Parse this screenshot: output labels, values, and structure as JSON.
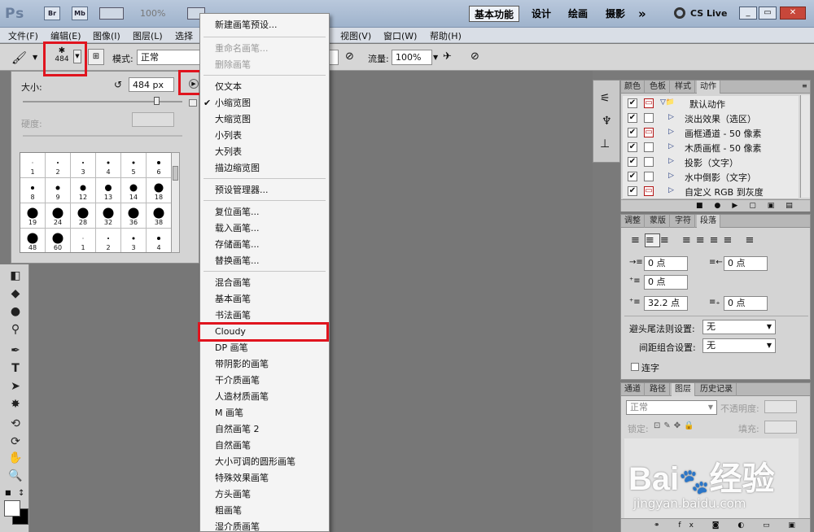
{
  "titlebar": {
    "app_logo": "Ps",
    "br_label": "Br",
    "mb_label": "Mb",
    "zoom": "100%",
    "workspaces": [
      "基本功能",
      "设计",
      "绘画",
      "摄影"
    ],
    "overflow": "»",
    "cs_live": "CS Live"
  },
  "menubar": {
    "items": [
      "文件(F)",
      "编辑(E)",
      "图像(I)",
      "图层(L)",
      "选择",
      "视图(V)",
      "窗口(W)",
      "帮助(H)"
    ]
  },
  "options": {
    "brush_size_small": "484",
    "mode_label": "模式:",
    "mode_value": "正常",
    "flow_label": "流量:",
    "flow_value": "100%"
  },
  "brush_panel": {
    "size_label": "大小:",
    "size_value": "484 px",
    "hardness_label": "硬度:",
    "presets": [
      "1",
      "2",
      "3",
      "4",
      "5",
      "6",
      "8",
      "9",
      "12",
      "13",
      "14",
      "18",
      "19",
      "24",
      "28",
      "32",
      "36",
      "38",
      "48",
      "60",
      "1",
      "2",
      "3",
      "4"
    ]
  },
  "dropdown": {
    "items": [
      {
        "label": "新建画笔预设...",
        "disabled": false
      },
      {
        "label": "重命名画笔...",
        "disabled": true
      },
      {
        "label": "删除画笔",
        "disabled": true
      },
      {
        "label": "仅文本",
        "disabled": false
      },
      {
        "label": "小缩览图",
        "disabled": false,
        "checked": true
      },
      {
        "label": "大缩览图",
        "disabled": false
      },
      {
        "label": "小列表",
        "disabled": false
      },
      {
        "label": "大列表",
        "disabled": false
      },
      {
        "label": "描边缩览图",
        "disabled": false
      },
      {
        "label": "预设管理器...",
        "disabled": false
      },
      {
        "label": "复位画笔...",
        "disabled": false
      },
      {
        "label": "载入画笔...",
        "disabled": false
      },
      {
        "label": "存储画笔...",
        "disabled": false
      },
      {
        "label": "替换画笔...",
        "disabled": false
      },
      {
        "label": "混合画笔",
        "disabled": false
      },
      {
        "label": "基本画笔",
        "disabled": false
      },
      {
        "label": "书法画笔",
        "disabled": false
      },
      {
        "label": "Cloudy",
        "disabled": false
      },
      {
        "label": "DP 画笔",
        "disabled": false
      },
      {
        "label": "带阴影的画笔",
        "disabled": false
      },
      {
        "label": "干介质画笔",
        "disabled": false
      },
      {
        "label": "人造材质画笔",
        "disabled": false
      },
      {
        "label": "M 画笔",
        "disabled": false
      },
      {
        "label": "自然画笔 2",
        "disabled": false
      },
      {
        "label": "自然画笔",
        "disabled": false
      },
      {
        "label": "大小可调的圆形画笔",
        "disabled": false
      },
      {
        "label": "特殊效果画笔",
        "disabled": false
      },
      {
        "label": "方头画笔",
        "disabled": false
      },
      {
        "label": "粗画笔",
        "disabled": false
      },
      {
        "label": "湿介质画笔",
        "disabled": false
      }
    ]
  },
  "actions_panel": {
    "tabs": [
      "颜色",
      "色板",
      "样式",
      "动作"
    ],
    "rows": [
      "默认动作",
      "淡出效果（选区）",
      "画框通道 - 50 像素",
      "木质画框 - 50 像素",
      "投影（文字）",
      "水中倒影（文字）",
      "自定义 RGB 到灰度"
    ]
  },
  "paragraph_panel": {
    "tabs": [
      "调整",
      "蒙版",
      "字符",
      "段落"
    ],
    "indent_left": "0 点",
    "indent_right": "0 点",
    "indent_first": "0 点",
    "space_before": "32.2 点",
    "space_after": "0 点",
    "kinsoku_label": "避头尾法则设置:",
    "kinsoku_value": "无",
    "mojikumi_label": "间距组合设置:",
    "mojikumi_value": "无",
    "hyphenate_label": "连字"
  },
  "layers_panel": {
    "tabs": [
      "通道",
      "路径",
      "图层",
      "历史记录"
    ],
    "blend_mode": "正常",
    "opacity_label": "不透明度:",
    "lock_label": "锁定:",
    "fill_label": "填充:"
  },
  "watermark": {
    "brand": "Bai",
    "brand_cn": "经验",
    "url": "jingyan.baidu.com"
  },
  "colors": {
    "highlight": "#e0141e"
  }
}
